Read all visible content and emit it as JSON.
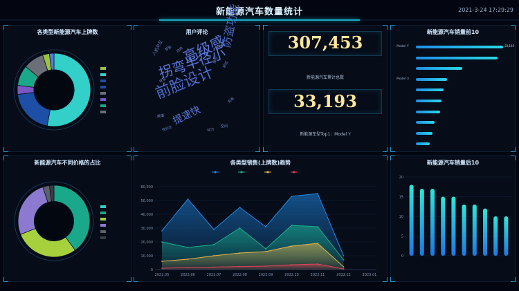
{
  "header": {
    "title": "新能源汽车数量统计",
    "time": "2021-3-24 17:29:29"
  },
  "panels": {
    "brand_donut_title": "各类型新能源汽车上牌数",
    "wordcloud_title": "用户评论",
    "kpi": {
      "total_value": "307,453",
      "total_caption": "新能源汽车累计总数",
      "top_value": "33,193",
      "top_caption": "新能源车型Top1：Model Y"
    },
    "sales_top_title": "新能源汽车销量前10",
    "price_donut_title": "新能源汽车不同价格的占比",
    "trend_title": "各类型销售(上牌数)趋势",
    "sales_bottom_title": "新能源汽车销量后10"
  },
  "wordcloud": [
    {
      "text": "高级感",
      "color": "#5876d6"
    },
    {
      "text": "防盗功能",
      "color": "#4a6bc4"
    },
    {
      "text": "拐弯半径小",
      "color": "#5b79d9"
    },
    {
      "text": "前脸设计",
      "color": "#4c6ccb"
    },
    {
      "text": "提速快",
      "color": "#5a77d4"
    },
    {
      "text": "人机交互",
      "color": "#6f86c9"
    },
    {
      "text": "续航",
      "color": "#7a8fd0"
    },
    {
      "text": "颜值",
      "color": "#7f92c8"
    },
    {
      "text": "空间",
      "color": "#7488c6"
    },
    {
      "text": "智能",
      "color": "#6a82c8"
    },
    {
      "text": "内饰",
      "color": "#7c8ec6"
    },
    {
      "text": "舒适",
      "color": "#7084c3"
    },
    {
      "text": "操控",
      "color": "#6b80c2"
    },
    {
      "text": "安全",
      "color": "#7d90c8"
    },
    {
      "text": "性价比",
      "color": "#6e84c4"
    },
    {
      "text": "充电",
      "color": "#7286c6"
    },
    {
      "text": "动力",
      "color": "#7a8cc6"
    }
  ],
  "chart_data": [
    {
      "id": "brand_donut",
      "type": "pie",
      "title": "各类型新能源汽车上牌数",
      "hole": 0.55,
      "slices": [
        {
          "name": "",
          "value": 53,
          "color": "#33cfc9"
        },
        {
          "name": "",
          "value": 20,
          "color": "#1d4fa6"
        },
        {
          "name": "",
          "value": 4,
          "color": "#7a57c3"
        },
        {
          "name": "",
          "value": 9,
          "color": "#1aa88a"
        },
        {
          "name": "",
          "value": 9,
          "color": "#6b6f78"
        },
        {
          "name": "",
          "value": 3,
          "color": "#9ac43f"
        },
        {
          "name": "",
          "value": 2,
          "color": "#5b79d9"
        }
      ],
      "legend": [
        {
          "name": "",
          "color": "#9ac43f"
        },
        {
          "name": "",
          "color": "#33cfc9"
        },
        {
          "name": "",
          "color": "#1d4fa6"
        },
        {
          "name": "",
          "color": "#1d4fa6"
        },
        {
          "name": "",
          "color": "#6b6f78"
        },
        {
          "name": "",
          "color": "#7a57c3"
        },
        {
          "name": "",
          "color": "#1aa88a"
        },
        {
          "name": "",
          "color": "#6b6f78"
        }
      ]
    },
    {
      "id": "sales_top",
      "type": "bar",
      "title": "新能源汽车销量前10",
      "categories": [
        "Model Y",
        "",
        "",
        "Model 3",
        "",
        "",
        "",
        "",
        "",
        ""
      ],
      "values": [
        33193,
        31000,
        17500,
        11800,
        10500,
        9800,
        9100,
        7000,
        6300,
        5200
      ],
      "value_labels": [
        "33,193",
        "",
        "",
        "",
        "",
        "",
        "",
        "",
        "",
        ""
      ],
      "xlim": [
        0,
        35000
      ]
    },
    {
      "id": "price_donut",
      "type": "pie",
      "title": "新能源汽车不同价格的占比",
      "hole": 0.55,
      "slices": [
        {
          "name": "",
          "value": 40,
          "color": "#1aa88a"
        },
        {
          "name": "",
          "value": 29,
          "color": "#a6d13d"
        },
        {
          "name": "",
          "value": 26,
          "color": "#8c7ad0"
        },
        {
          "name": "",
          "value": 3,
          "color": "#5c6068"
        },
        {
          "name": "",
          "value": 2,
          "color": "#3a3d44"
        }
      ],
      "legend": [
        {
          "name": "",
          "color": "#33cfc9"
        },
        {
          "name": "",
          "color": "#1aa88a"
        },
        {
          "name": "",
          "color": "#a6d13d"
        },
        {
          "name": "",
          "color": "#8c7ad0"
        },
        {
          "name": "",
          "color": "#5c6068"
        },
        {
          "name": "",
          "color": "#3a3d44"
        }
      ]
    },
    {
      "id": "trend",
      "type": "area",
      "title": "各类型销售(上牌数)趋势",
      "categories": [
        "2022.05",
        "2022.06",
        "2022.07",
        "2022.08",
        "2022.09",
        "2022.10",
        "2022.11",
        "2022.12",
        "2023.01"
      ],
      "ylim": [
        0,
        60000
      ],
      "yticks": [
        "0",
        "10,000",
        "20,000",
        "30,000",
        "40,000",
        "50,000",
        "60,000"
      ],
      "grid": true,
      "legend_position": "top",
      "series": [
        {
          "name": "",
          "color": "#1e88e5",
          "values": [
            28000,
            51000,
            29000,
            45000,
            31000,
            53000,
            55000,
            10000
          ]
        },
        {
          "name": "",
          "color": "#19b38a",
          "values": [
            20000,
            16000,
            18000,
            30000,
            15000,
            32000,
            31000,
            7000
          ]
        },
        {
          "name": "",
          "color": "#e8b54a",
          "values": [
            6000,
            7500,
            10000,
            12000,
            13000,
            17000,
            19000,
            2000
          ]
        },
        {
          "name": "",
          "color": "#e0445a",
          "values": [
            1000,
            1500,
            1800,
            2200,
            2500,
            3500,
            4000,
            500
          ]
        }
      ]
    },
    {
      "id": "sales_bottom",
      "type": "bar",
      "title": "新能源汽车销量后10",
      "categories": [
        "",
        "",
        "",
        "",
        "",
        "",
        "",
        "",
        "",
        ""
      ],
      "values": [
        18,
        17,
        17,
        15,
        15,
        13,
        13,
        12,
        10,
        10
      ],
      "ylim": [
        0,
        20
      ],
      "yticks": [
        "0",
        "5",
        "10",
        "15",
        "20"
      ]
    }
  ],
  "colors": {
    "accent": "#1aa9c4",
    "kpi": "#ffe69a",
    "background": "#030610"
  }
}
